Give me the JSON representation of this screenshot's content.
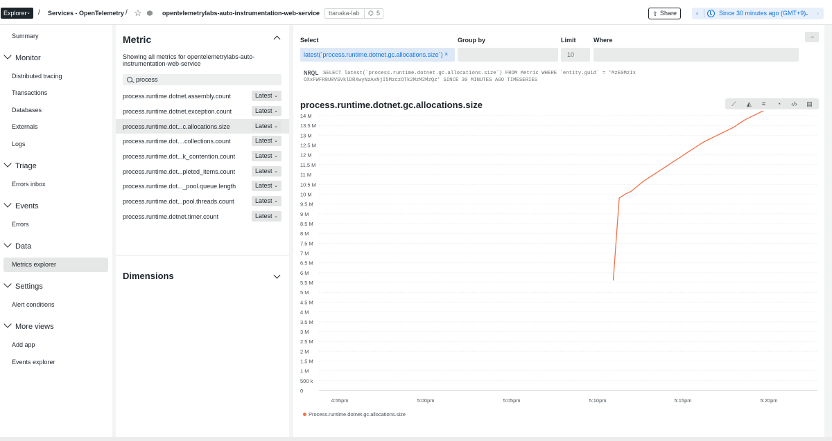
{
  "topbar": {
    "explorer_label": "Explorer",
    "crumb_separator": "/",
    "services_label": "Services - OpenTelemetry",
    "entity_name": "opentelemetrylabs-auto-instrumentation-web-service",
    "account": "ttanaka-lab",
    "tag_count": "5",
    "share_label": "Share",
    "time_label": "Since 30 minutes ago (GMT+9)"
  },
  "sidebar": {
    "summary": "Summary",
    "sections": [
      {
        "title": "Monitor",
        "items": [
          "Distributed tracing",
          "Transactions",
          "Databases",
          "Externals",
          "Logs"
        ]
      },
      {
        "title": "Triage",
        "items": [
          "Errors inbox"
        ]
      },
      {
        "title": "Events",
        "items": [
          "Errors"
        ]
      },
      {
        "title": "Data",
        "items": [
          "Metrics explorer"
        ]
      },
      {
        "title": "Settings",
        "items": [
          "Alert conditions"
        ]
      },
      {
        "title": "More views",
        "items": [
          "Add app",
          "Events explorer"
        ]
      }
    ]
  },
  "metric_panel": {
    "title": "Metric",
    "description": "Showing all metrics for opentelemetrylabs-auto-instrumentation-web-service",
    "search_value": "process",
    "metrics": [
      "process.runtime.dotnet.assembly.count",
      "process.runtime.dotnet.exception.count",
      "process.runtime.dot...c.allocations.size",
      "process.runtime.dot....collections.count",
      "process.runtime.dot...k_contention.count",
      "process.runtime.dot...pleted_items.count",
      "process.runtime.dot..._pool.queue.length",
      "process.runtime.dot...pool.threads.count",
      "process.runtime.dotnet.timer.count"
    ],
    "aggregation_label": "Latest",
    "dimensions_title": "Dimensions"
  },
  "query": {
    "select_label": "Select",
    "select_value": "latest(`process.runtime.dotnet.gc.allocations.size`)",
    "group_by_label": "Group by",
    "limit_label": "Limit",
    "limit_value": "10",
    "where_label": "Where",
    "more_label": "...",
    "nrql_label": "NRQL",
    "nrql_query": "SELECT latest(`process.runtime.dotnet.gc.allocations.size`) FROM Metric WHERE `entity.guid` = 'MzE0MzIxOXxFWFR8U0VSVklDRXwyNzAxNjI5MzczOTk2MzM2MzQz' SINCE 30 MINUTES AGO TIMESERIES"
  },
  "chart_data": {
    "type": "line",
    "title": "process.runtime.dotnet.gc.allocations.size",
    "y_tick_labels": [
      "0",
      "500 k",
      "1 M",
      "1.5 M",
      "2 M",
      "2.5 M",
      "3 M",
      "3.5 M",
      "4 M",
      "4.5 M",
      "5 M",
      "5.5 M",
      "6 M",
      "6.5 M",
      "7 M",
      "7.5 M",
      "8 M",
      "8.5 M",
      "9 M",
      "9.5 M",
      "10 M",
      "10.5 M",
      "11 M",
      "11.5 M",
      "12 M",
      "12.5 M",
      "13 M",
      "13.5 M",
      "14 M"
    ],
    "x_tick_labels": [
      "4:55pm",
      "5:00pm",
      "5:05pm",
      "5:10pm",
      "5:15pm",
      "5:20pm"
    ],
    "ylim": [
      0,
      14000000
    ],
    "x_range_minutes": [
      -40,
      43
    ],
    "series": [
      {
        "name": "Process.runtime.dotnet.gc.allocations.size",
        "color": "#f0714b",
        "x_minutes": [
          9,
          10,
          11,
          12,
          13,
          14,
          15,
          16,
          17,
          18,
          19,
          20,
          21,
          22,
          23,
          24,
          25,
          26,
          27,
          28,
          29,
          30,
          31,
          32,
          33,
          34,
          35,
          36
        ],
        "values": [
          5600000,
          9800000,
          10000000,
          10150000,
          10400000,
          10650000,
          10850000,
          11050000,
          11250000,
          11450000,
          11650000,
          11850000,
          12050000,
          12250000,
          12450000,
          12650000,
          12800000,
          12950000,
          13100000,
          13250000,
          13400000,
          13600000,
          13800000,
          13950000,
          14100000,
          14250000,
          14400000,
          14550000
        ]
      }
    ],
    "grid": true,
    "legend_position": "bottom-left"
  }
}
